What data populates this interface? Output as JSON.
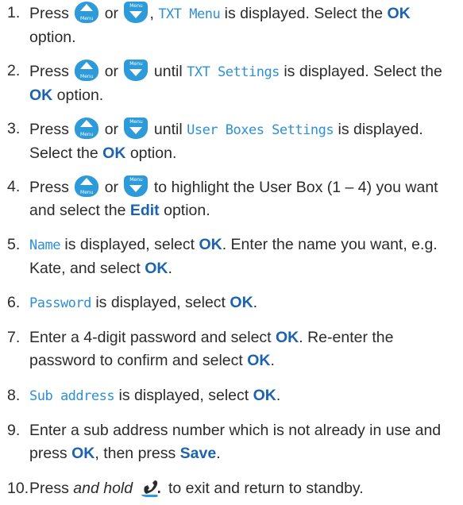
{
  "key_labels": {
    "up_caption": "Menu",
    "down_caption": "Menu"
  },
  "icons": {
    "up": "up-menu-key-icon",
    "down": "down-menu-key-icon",
    "end": "end-call-key-icon"
  },
  "colors": {
    "lcd_text": "#2d8fd5",
    "emphasis": "#1b63b0",
    "key": "#2d9ad9"
  },
  "steps": [
    {
      "num": "1.",
      "t1": "Press",
      "t2": "or",
      "t3": ",",
      "lcd": "TXT Menu",
      "t4": "is displayed. Select the",
      "b": "OK",
      "t5": "option."
    },
    {
      "num": "2.",
      "t1": "Press",
      "t2": "or",
      "t3": "until",
      "lcd": "TXT Settings",
      "t4": "is displayed. Select the",
      "b": "OK",
      "t5": "option."
    },
    {
      "num": "3.",
      "t1": "Press",
      "t2": "or",
      "t3": "until",
      "lcd": "User Boxes Settings",
      "t4": "is displayed. Select the",
      "b": "OK",
      "t5": "option."
    },
    {
      "num": "4.",
      "t1": "Press",
      "t2": "or",
      "t3": "to highlight the User Box (1 – 4) you want and select the",
      "b": "Edit",
      "t4": "option."
    },
    {
      "num": "5.",
      "lcd": "Name",
      "t1": "is displayed, select",
      "b1": "OK",
      "t2": ". Enter the name you want, e.g. Kate, and select",
      "b2": "OK",
      "t3": "."
    },
    {
      "num": "6.",
      "lcd": "Password",
      "t1": "is displayed, select",
      "b1": "OK",
      "t2": "."
    },
    {
      "num": "7.",
      "t1": "Enter a 4-digit password and select",
      "b1": "OK",
      "t2": ". Re-enter the password to confirm and select",
      "b2": "OK",
      "t3": "."
    },
    {
      "num": "8.",
      "lcd": "Sub address",
      "t1": "is displayed, select",
      "b1": "OK",
      "t2": "."
    },
    {
      "num": "9.",
      "t1": "Enter a sub address number which is not already in use and press",
      "b1": "OK",
      "t2": ", then press",
      "b2": "Save",
      "t3": "."
    },
    {
      "num": "10.",
      "t1": "Press",
      "i": "and hold",
      "t2": "to exit and return to standby."
    }
  ]
}
